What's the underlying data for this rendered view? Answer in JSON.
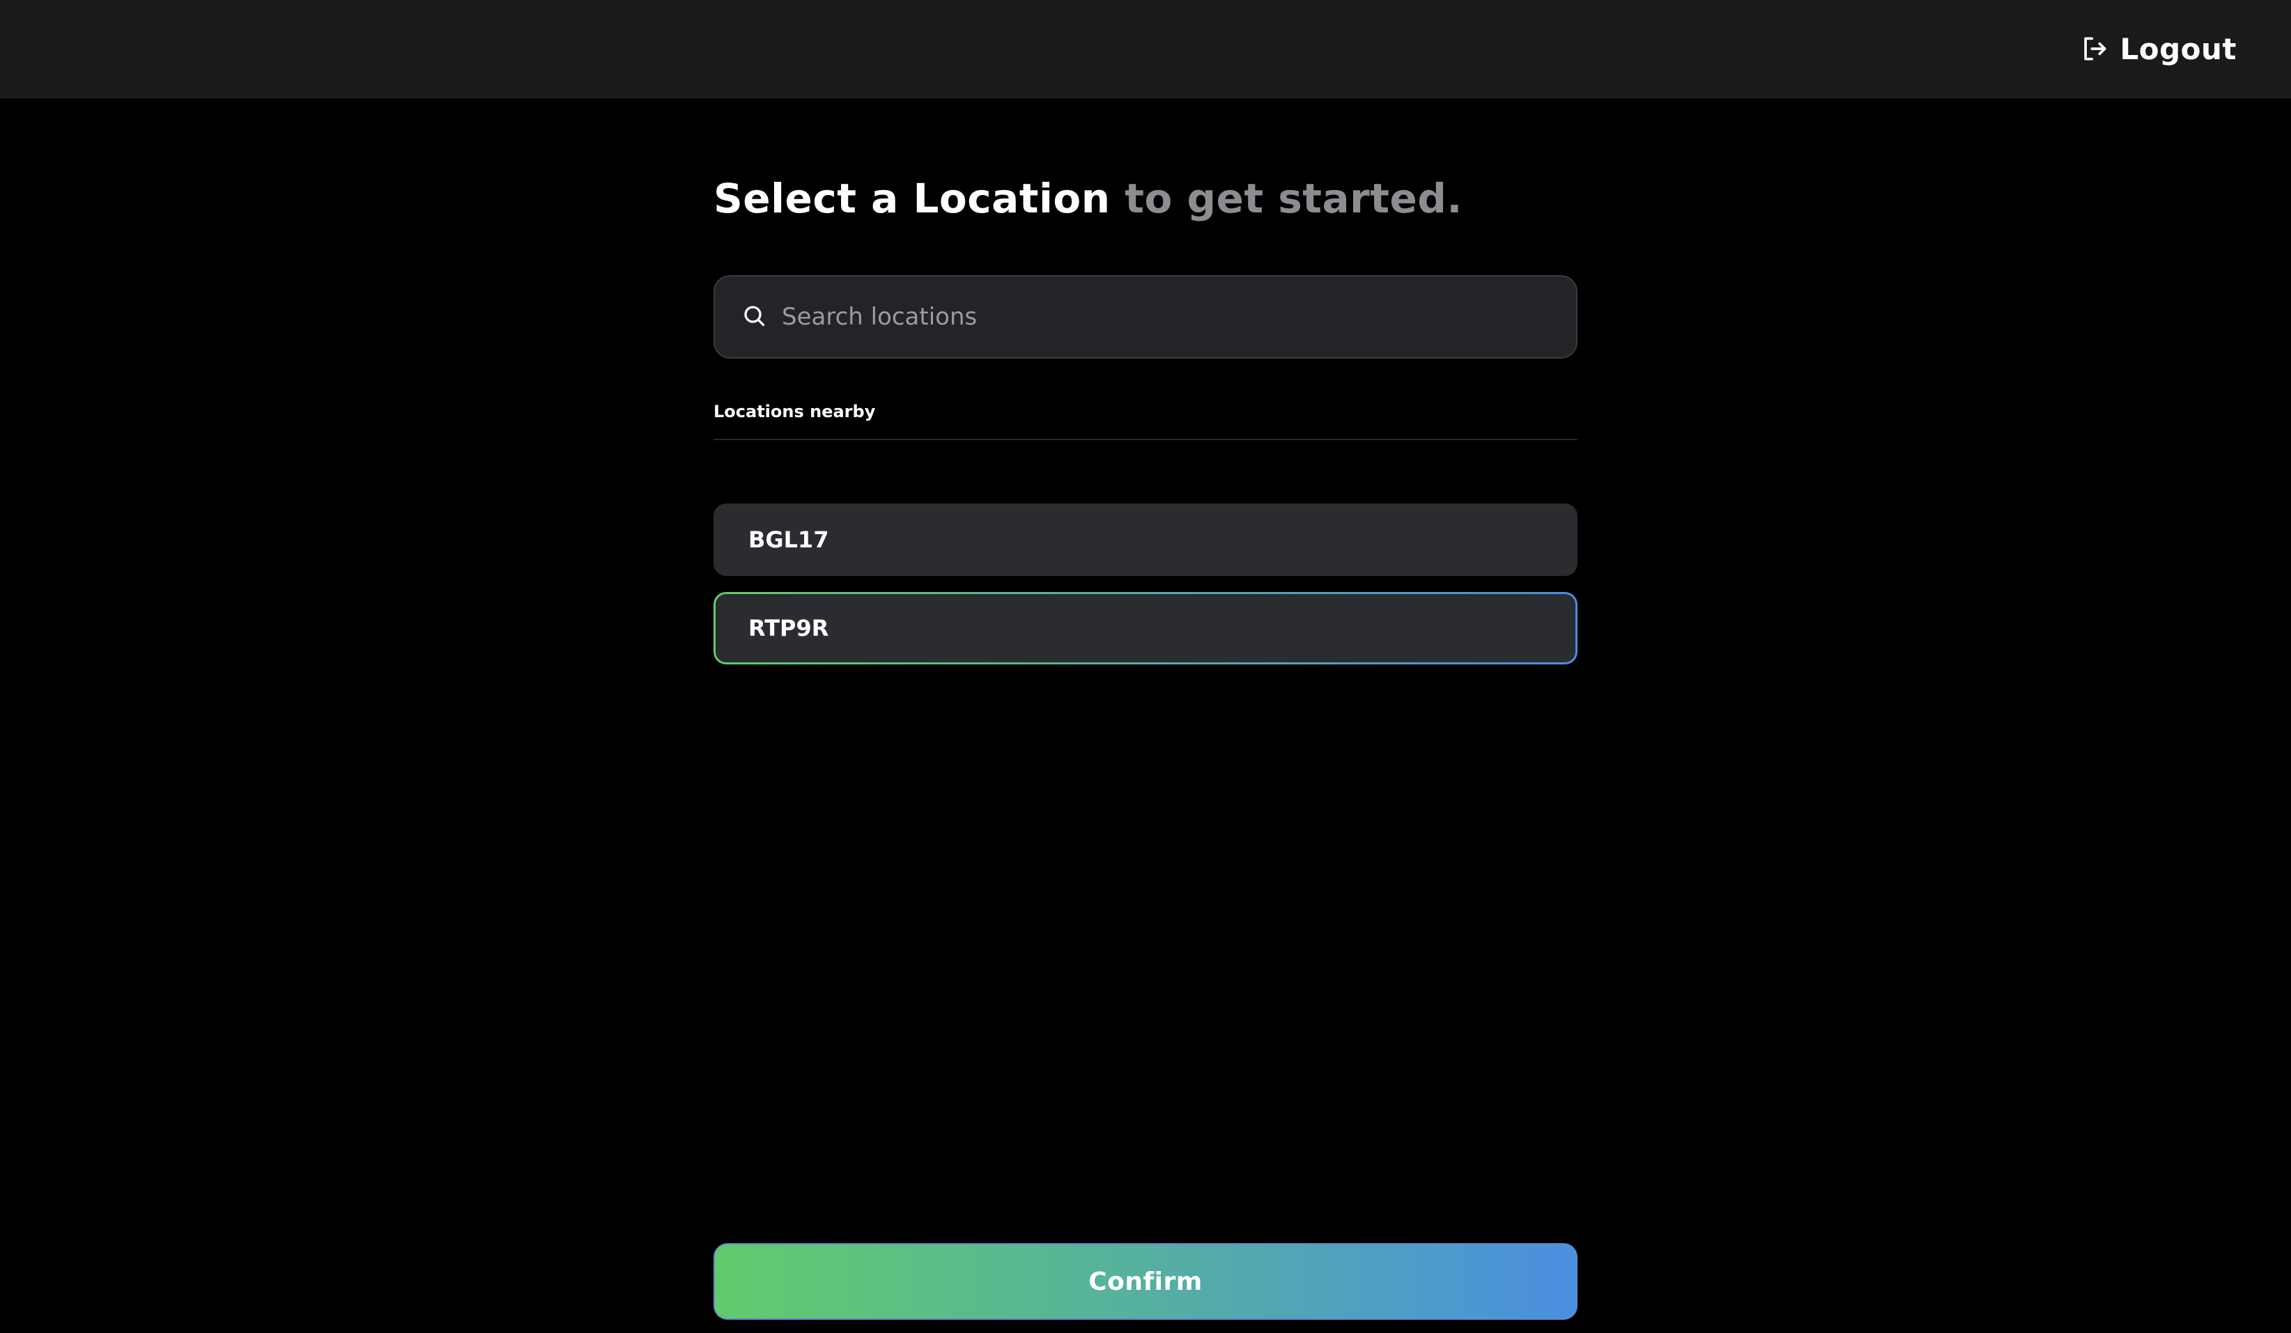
{
  "header": {
    "logout_label": "Logout",
    "logout_icon": "logout-icon"
  },
  "main": {
    "heading_strong": "Select a Location",
    "heading_muted": "to get started.",
    "search": {
      "placeholder": "Search locations",
      "value": "",
      "icon": "search-icon"
    },
    "section_label": "Locations nearby",
    "locations": [
      {
        "label": "BGL17",
        "selected": false
      },
      {
        "label": "RTP9R",
        "selected": true
      }
    ],
    "confirm_label": "Confirm"
  },
  "colors": {
    "background": "#000000",
    "topbar": "#1a1a1b",
    "card": "#2a2c30",
    "accent_green": "#62cb6c",
    "accent_blue": "#4a8fe0",
    "muted_text": "#8b8d91"
  }
}
